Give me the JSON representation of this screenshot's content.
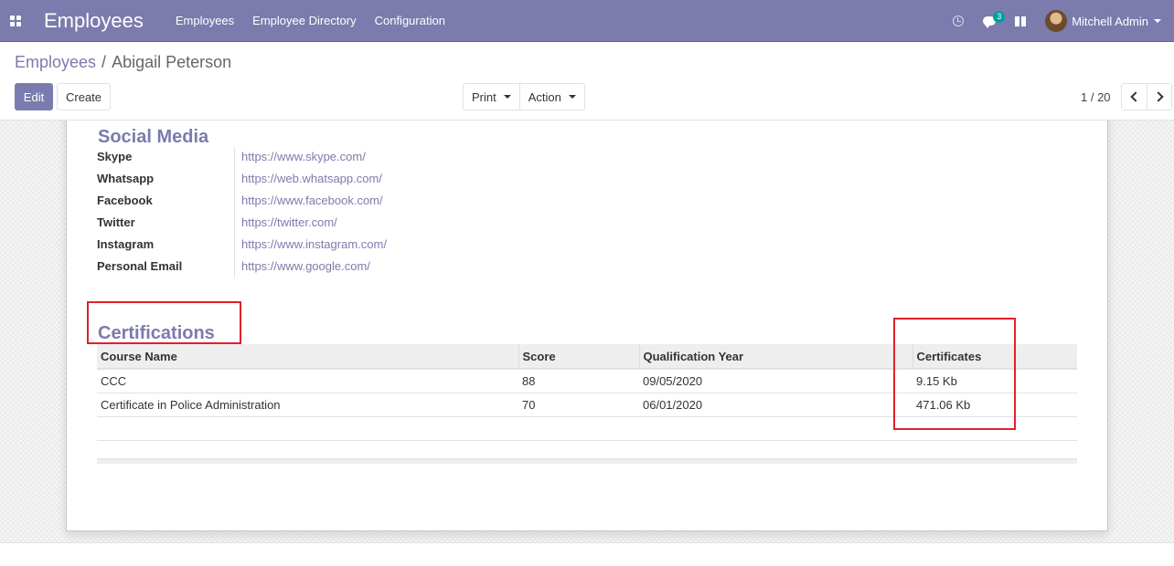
{
  "navbar": {
    "app_title": "Employees",
    "menu": [
      "Employees",
      "Employee Directory",
      "Configuration"
    ],
    "messages_count": "3",
    "user_name": "Mitchell Admin"
  },
  "breadcrumb": {
    "parent": "Employees",
    "separator": "/",
    "current": "Abigail Peterson"
  },
  "toolbar": {
    "edit_label": "Edit",
    "create_label": "Create",
    "print_label": "Print",
    "action_label": "Action",
    "pager": "1 / 20"
  },
  "social_media": {
    "title": "Social Media",
    "rows": [
      {
        "label": "Skype",
        "value": "https://www.skype.com/"
      },
      {
        "label": "Whatsapp",
        "value": "https://web.whatsapp.com/"
      },
      {
        "label": "Facebook",
        "value": "https://www.facebook.com/"
      },
      {
        "label": "Twitter",
        "value": "https://twitter.com/"
      },
      {
        "label": "Instagram",
        "value": "https://www.instagram.com/"
      },
      {
        "label": "Personal Email",
        "value": "https://www.google.com/"
      }
    ]
  },
  "certifications": {
    "title": "Certifications",
    "columns": [
      "Course Name",
      "Score",
      "Qualification Year",
      "Certificates"
    ],
    "rows": [
      {
        "course": "CCC",
        "score": "88",
        "year": "09/05/2020",
        "certificate": "9.15 Kb"
      },
      {
        "course": "Certificate in Police Administration",
        "score": "70",
        "year": "06/01/2020",
        "certificate": "471.06 Kb"
      }
    ]
  },
  "colors": {
    "brand": "#7c7bad",
    "highlight": "#e0202a"
  },
  "icons": [
    "apps-icon",
    "clock-icon",
    "chat-icon",
    "gift-icon",
    "chevron-left-icon",
    "chevron-right-icon",
    "caret-down-icon"
  ]
}
